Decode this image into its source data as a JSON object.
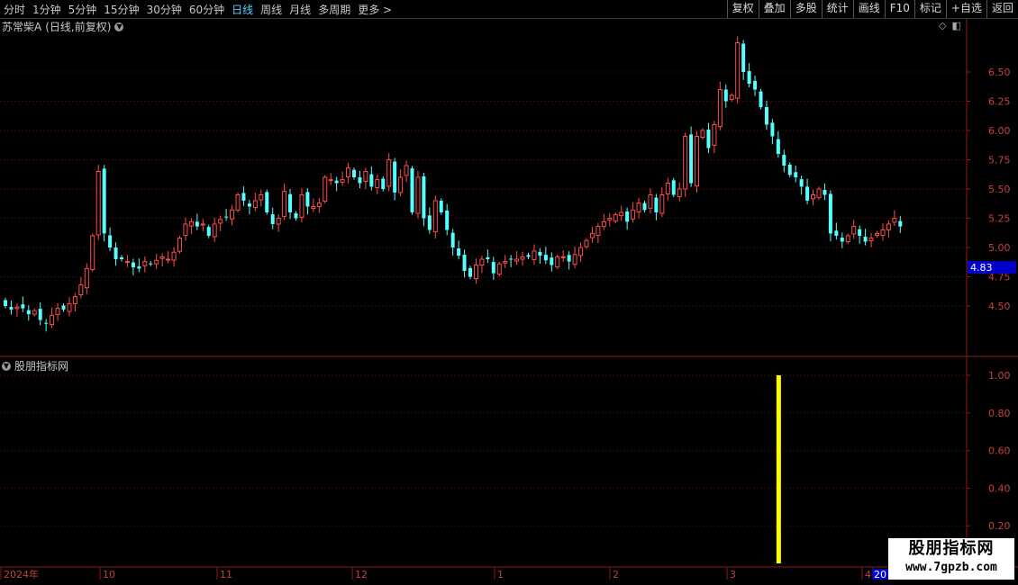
{
  "toolbar": {
    "periods": [
      {
        "label": "分时",
        "active": false
      },
      {
        "label": "1分钟",
        "active": false
      },
      {
        "label": "5分钟",
        "active": false
      },
      {
        "label": "15分钟",
        "active": false
      },
      {
        "label": "30分钟",
        "active": false
      },
      {
        "label": "60分钟",
        "active": false
      },
      {
        "label": "日线",
        "active": true
      },
      {
        "label": "周线",
        "active": false
      },
      {
        "label": "月线",
        "active": false
      },
      {
        "label": "多周期",
        "active": false
      },
      {
        "label": "更多 >",
        "active": false
      }
    ],
    "actions": [
      "复权",
      "叠加",
      "多股",
      "统计",
      "画线",
      "F10",
      "标记",
      "+自选",
      "返回"
    ]
  },
  "main_chart": {
    "title": "苏常柴A",
    "subtitle": "(日线,前复权)",
    "current_price": "4.83"
  },
  "indicator": {
    "title": "股朋指标网"
  },
  "watermark": {
    "line1": "股朋指标网",
    "line2": "www.7gpzb.com"
  },
  "colors": {
    "up": "#ff4d4d",
    "down": "#54ffff",
    "grid": "#7a0000",
    "axis": "#8b1a1a",
    "indicator_bar": "#ffff00",
    "price_tag": "#0000c8"
  },
  "chart_data": [
    {
      "type": "candlestick",
      "title": "苏常柴A (日线,前复权)",
      "ylim": [
        4.25,
        6.85
      ],
      "y_ticks": [
        "6.50",
        "6.25",
        "6.00",
        "5.75",
        "5.50",
        "5.25",
        "5.00",
        "4.75",
        "4.50"
      ],
      "x_labels": [
        "2024年",
        "10",
        "11",
        "12",
        "1",
        "2",
        "3",
        "4",
        "20"
      ],
      "close": [
        4.5,
        4.47,
        4.49,
        4.48,
        4.43,
        4.46,
        4.38,
        4.35,
        4.42,
        4.48,
        4.47,
        4.52,
        4.58,
        4.68,
        4.82,
        5.1,
        5.65,
        5.12,
        5.0,
        4.9,
        4.9,
        4.88,
        4.83,
        4.82,
        4.88,
        4.86,
        4.89,
        4.92,
        4.9,
        4.96,
        5.08,
        5.2,
        5.22,
        5.18,
        5.2,
        5.1,
        5.2,
        5.24,
        5.26,
        5.32,
        5.45,
        5.4,
        5.35,
        5.4,
        5.45,
        5.3,
        5.2,
        5.25,
        5.48,
        5.3,
        5.25,
        5.45,
        5.35,
        5.35,
        5.38,
        5.6,
        5.58,
        5.55,
        5.58,
        5.68,
        5.6,
        5.55,
        5.65,
        5.52,
        5.58,
        5.5,
        5.75,
        5.47,
        5.6,
        5.7,
        5.3,
        5.6,
        5.25,
        5.15,
        5.4,
        5.3,
        5.15,
        5.0,
        4.93,
        4.8,
        4.75,
        4.85,
        4.9,
        4.9,
        4.78,
        4.86,
        4.88,
        4.9,
        4.9,
        4.92,
        4.92,
        4.97,
        4.93,
        4.89,
        4.85,
        4.92,
        4.92,
        4.88,
        4.94,
        5.0,
        5.06,
        5.12,
        5.18,
        5.22,
        5.25,
        5.28,
        5.3,
        5.22,
        5.32,
        5.38,
        5.32,
        5.45,
        5.3,
        5.45,
        5.55,
        5.45,
        5.5,
        5.95,
        5.55,
        5.95,
        6.0,
        5.85,
        6.05,
        6.35,
        6.25,
        6.3,
        6.75,
        6.5,
        6.4,
        6.35,
        6.2,
        6.05,
        5.95,
        5.8,
        5.7,
        5.62,
        5.6,
        5.52,
        5.4,
        5.45,
        5.5,
        5.45,
        5.12,
        5.1,
        5.05,
        5.1,
        5.18,
        5.1,
        5.05,
        5.08,
        5.12,
        5.15,
        5.2,
        5.25,
        5.18
      ]
    },
    {
      "type": "bar",
      "title": "股朋指标网",
      "ylim": [
        0,
        1.1
      ],
      "y_ticks": [
        "1.00",
        "0.80",
        "0.60",
        "0.40",
        "0.20"
      ],
      "signal_index": 133,
      "signal_value": 1.0
    }
  ]
}
